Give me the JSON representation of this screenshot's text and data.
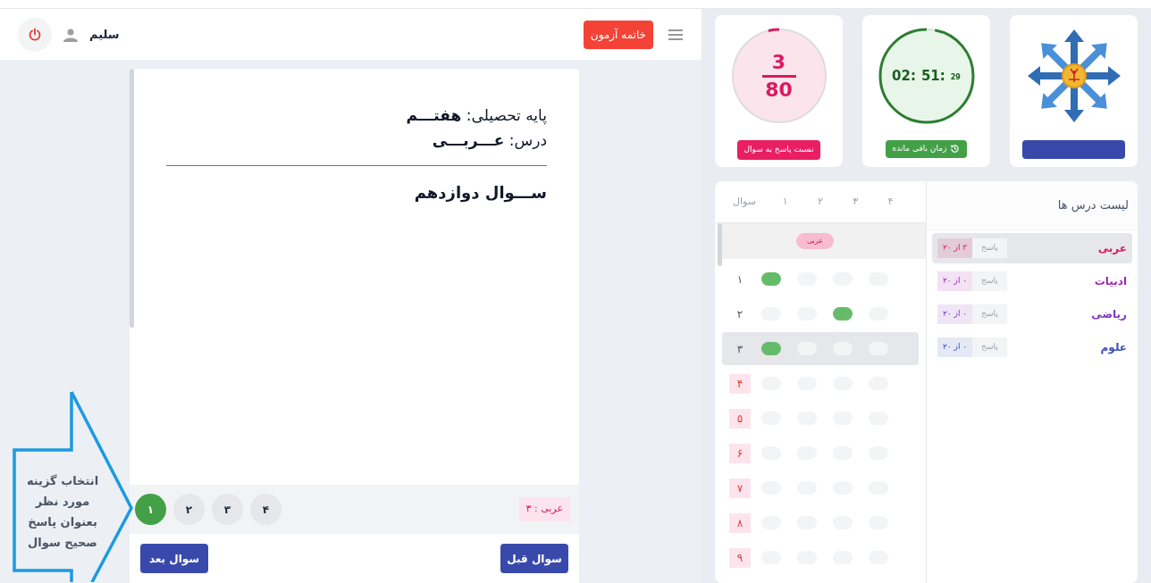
{
  "header": {
    "end_exam_button": "خاتمه آزمون",
    "user_name": "سلیم"
  },
  "stats": {
    "answered": {
      "count": "3",
      "total": "80",
      "label": "نسبت پاسخ به سوال",
      "level": 0.0375
    },
    "timer": {
      "hours": "02:",
      "minutes": "51:",
      "seconds": "29",
      "label": "زمان باقی مانده",
      "level": 0.97
    }
  },
  "question": {
    "grade": "پایه تحصیلی: **هفتـــم**",
    "lesson": "درس: **عـــربـــی**",
    "title": "ســـوال دوازدهم",
    "options": [
      {
        "label": "۴",
        "selected": false
      },
      {
        "label": "۳",
        "selected": false
      },
      {
        "label": "۲",
        "selected": false
      },
      {
        "label": "۱",
        "selected": true
      }
    ],
    "tag": "عربی : ۳",
    "next_button": "سوال بعد",
    "prev_button": "سوال قبل"
  },
  "annotation": {
    "lines": [
      "انتخاب گزینه",
      "مورد نظر",
      "بعنوان پاسخ",
      "صحیح سوال"
    ]
  },
  "answer_sheet": {
    "columns": [
      "۴",
      "۳",
      "۲",
      "۱",
      "سوال"
    ],
    "section": "عربی",
    "rows": [
      {
        "number": "۱",
        "answered": true,
        "selected": false,
        "choices": [
          {
            "filled": false
          },
          {
            "filled": false
          },
          {
            "filled": false
          },
          {
            "filled": true
          }
        ]
      },
      {
        "number": "۲",
        "answered": true,
        "selected": false,
        "choices": [
          {
            "filled": false
          },
          {
            "filled": true
          },
          {
            "filled": false
          },
          {
            "filled": false
          }
        ]
      },
      {
        "number": "۳",
        "answered": true,
        "selected": true,
        "choices": [
          {
            "filled": false
          },
          {
            "filled": false
          },
          {
            "filled": false
          },
          {
            "filled": true
          }
        ]
      },
      {
        "number": "۴",
        "answered": false,
        "selected": false,
        "choices": [
          {
            "filled": false
          },
          {
            "filled": false
          },
          {
            "filled": false
          },
          {
            "filled": false
          }
        ]
      },
      {
        "number": "۵",
        "answered": false,
        "selected": false,
        "choices": [
          {
            "filled": false
          },
          {
            "filled": false
          },
          {
            "filled": false
          },
          {
            "filled": false
          }
        ]
      },
      {
        "number": "۶",
        "answered": false,
        "selected": false,
        "choices": [
          {
            "filled": false
          },
          {
            "filled": false
          },
          {
            "filled": false
          },
          {
            "filled": false
          }
        ]
      },
      {
        "number": "۷",
        "answered": false,
        "selected": false,
        "choices": [
          {
            "filled": false
          },
          {
            "filled": false
          },
          {
            "filled": false
          },
          {
            "filled": false
          }
        ]
      },
      {
        "number": "۸",
        "answered": false,
        "selected": false,
        "choices": [
          {
            "filled": false
          },
          {
            "filled": false
          },
          {
            "filled": false
          },
          {
            "filled": false
          }
        ]
      },
      {
        "number": "۹",
        "answered": false,
        "selected": false,
        "choices": [
          {
            "filled": false
          },
          {
            "filled": false
          },
          {
            "filled": false
          },
          {
            "filled": false
          }
        ]
      }
    ]
  },
  "lessons": {
    "title": "لیست درس ها",
    "items": [
      {
        "name": "عربی",
        "answer_label": "پاسخ",
        "progress": "۳ از ۲۰",
        "selected": true,
        "color": "#d81b60"
      },
      {
        "name": "ادبیات",
        "answer_label": "پاسخ",
        "progress": "۰ از ۲۰",
        "selected": false,
        "color": "#9c27b0"
      },
      {
        "name": "ریاضی",
        "answer_label": "پاسخ",
        "progress": "۰ از ۲۰",
        "selected": false,
        "color": "#7e3ac0"
      },
      {
        "name": "علوم",
        "answer_label": "پاسخ",
        "progress": "۰ از ۲۰",
        "selected": false,
        "color": "#3f51b5"
      }
    ]
  }
}
